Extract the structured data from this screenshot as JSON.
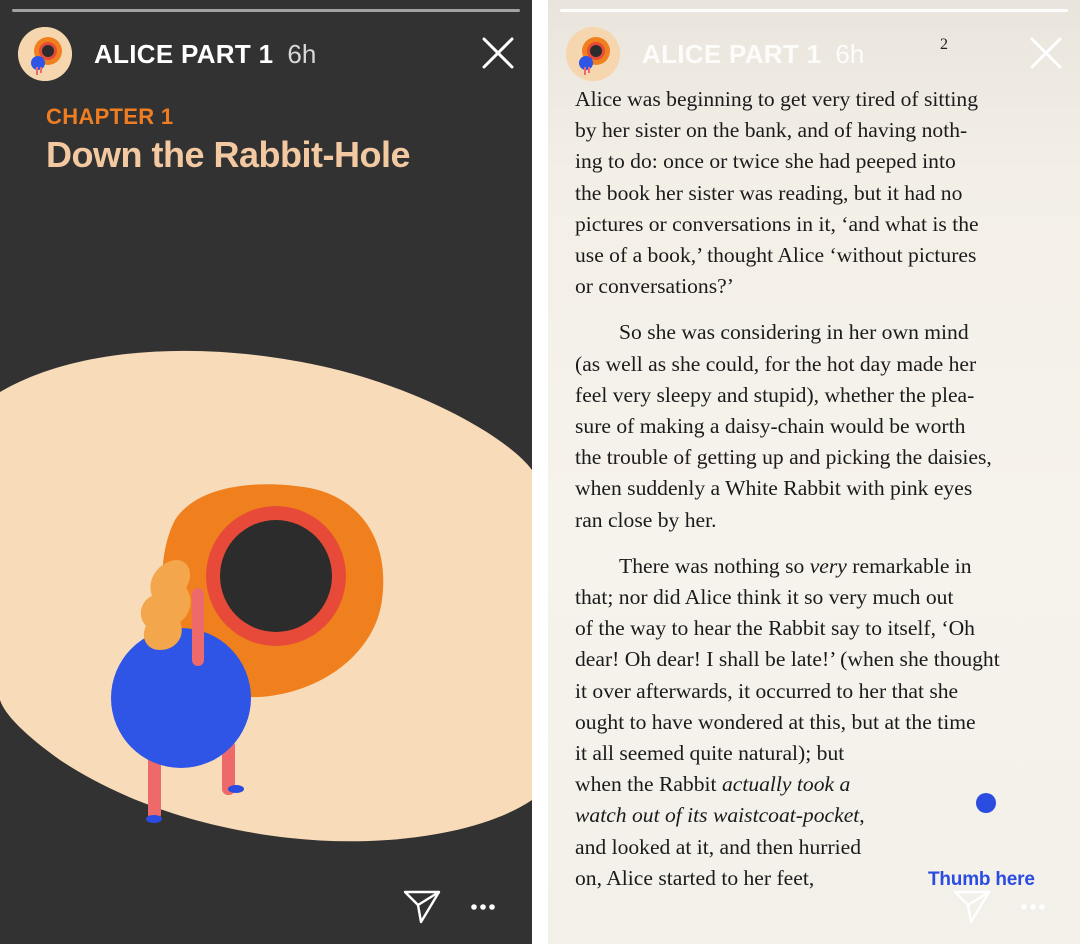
{
  "colors": {
    "dark_background": "#333232",
    "accent_orange": "#ef7d22",
    "title_peach": "#f3c9a2",
    "thumb_blue": "#2a4ce0"
  },
  "left_story": {
    "header": {
      "title": "ALICE PART 1",
      "time": "6h"
    },
    "chapter_label": "CHAPTER 1",
    "chapter_title": "Down the Rabbit-Hole",
    "icons": [
      "close-icon",
      "send-icon",
      "more-icon",
      "avatar-logo"
    ]
  },
  "right_story": {
    "header": {
      "title": "ALICE PART 1",
      "time": "6h"
    },
    "page_number": "2",
    "paragraphs": [
      {
        "lines": [
          "Alice was beginning to get very tired of sitting",
          "by her sister on the bank, and of having noth-",
          "ing to do: once or twice she had peeped into",
          "the book her sister was reading, but it had no",
          "pictures or conversations in it, ‘and what is the",
          "use of a book,’ thought Alice ‘without pictures",
          "or conversations?’"
        ]
      },
      {
        "lines": [
          "So she was considering in her own mind",
          "(as well as she could, for the hot day made her",
          "feel very sleepy and stupid), whether the plea-",
          "sure of making a daisy-chain would be worth",
          "the trouble of getting up and picking the daisies,",
          "when suddenly a White Rabbit with pink eyes",
          "ran close by her."
        ]
      },
      {
        "line1_a": "There was nothing so ",
        "line1_em": "very",
        "line1_b": " remarkable in",
        "lines": [
          "that; nor did Alice think it so very much out",
          "of the way to hear the Rabbit say to itself, ‘Oh",
          "dear! Oh dear! I shall be late!’ (when she thought",
          "it over afterwards, it occurred to her that she",
          "ought to have wondered at this, but at the time",
          "it all seemed quite natural); but"
        ],
        "line8_a": "when the Rabbit ",
        "line8_em": "actually took a",
        "line9_em": "watch out of its waistcoat-pocket",
        "line9_b": ",",
        "line10": "and looked at it, and then hurried",
        "line11": "on, Alice started to her feet,"
      }
    ],
    "thumb_label": "Thumb here"
  }
}
